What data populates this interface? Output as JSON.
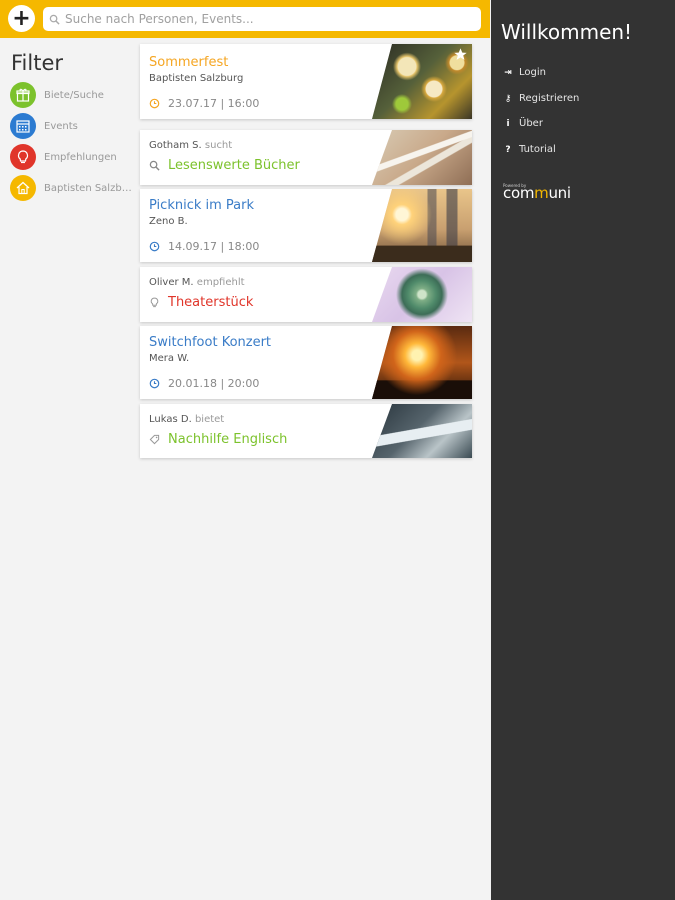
{
  "search": {
    "placeholder": "Suche nach Personen, Events..."
  },
  "add_button": {
    "label": "+"
  },
  "filter": {
    "title": "Filter",
    "items": [
      {
        "label": "Biete/Suche",
        "icon": "gift-icon",
        "color": "#7cc22c"
      },
      {
        "label": "Events",
        "icon": "calendar-icon",
        "color": "#2c7bd1"
      },
      {
        "label": "Empfehlungen",
        "icon": "lightbulb-icon",
        "color": "#e0352a"
      },
      {
        "label": "Baptisten Salzbu...",
        "icon": "home-icon",
        "color": "#f5b800"
      }
    ]
  },
  "cards": [
    {
      "title": "Sommerfest",
      "sub": "Baptisten Salzburg",
      "meta": "23.07.17 | 16:00",
      "featured": true
    },
    {
      "author": "Gotham S.",
      "action": "sucht",
      "title": "Lesenswerte Bücher"
    },
    {
      "title": "Picknick im Park",
      "sub": "Zeno B.",
      "meta": "14.09.17 | 18:00"
    },
    {
      "author": "Oliver M.",
      "action": "empfiehlt",
      "title": "Theaterstück"
    },
    {
      "title": "Switchfoot Konzert",
      "sub": "Mera W.",
      "meta": "20.01.18 | 20:00"
    },
    {
      "author": "Lukas D.",
      "action": "bietet",
      "title": "Nachhilfe Englisch"
    }
  ],
  "colors": {
    "accent": "#f5b800",
    "event_blue": "#3a7cc7",
    "offer_green": "#7cc22c",
    "recommend_red": "#e0352a",
    "panel_dark": "#333333"
  },
  "panel": {
    "welcome": "Willkommen!",
    "menu": [
      {
        "label": "Login",
        "icon": "login-icon",
        "glyph": "⇥"
      },
      {
        "label": "Registrieren",
        "icon": "key-icon",
        "glyph": "⚷"
      },
      {
        "label": "Über",
        "icon": "info-icon",
        "glyph": "i"
      },
      {
        "label": "Tutorial",
        "icon": "help-icon",
        "glyph": "?"
      }
    ],
    "brand": {
      "powered": "Powered by",
      "logo_pre": "com",
      "logo_mid": "m",
      "logo_post": "uni"
    }
  }
}
